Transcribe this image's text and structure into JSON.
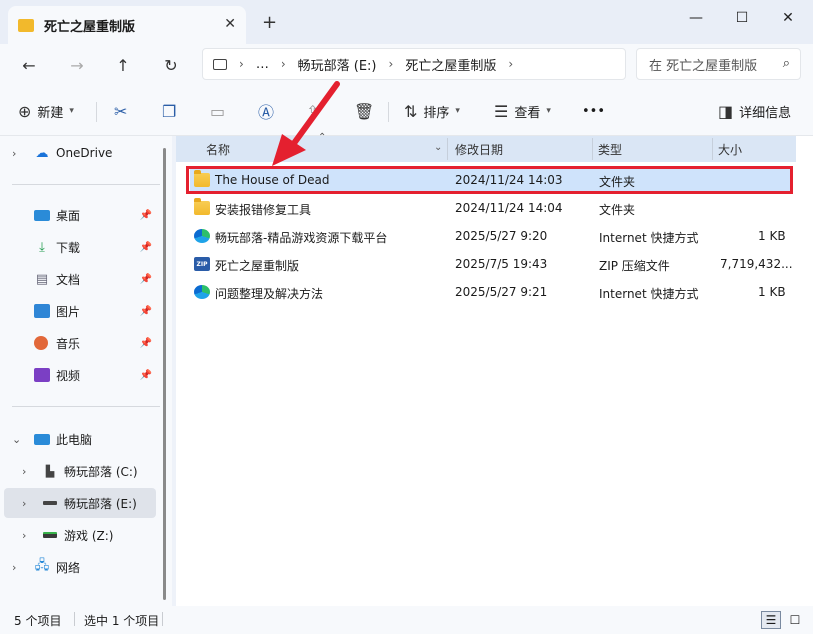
{
  "window": {
    "tab_title": "死亡之屋重制版",
    "close_tab": "✕",
    "new_tab": "+",
    "minimize": "—",
    "maximize": "☐",
    "close": "✕"
  },
  "nav": {
    "back": "←",
    "forward": "→",
    "up": "↑",
    "refresh": "↻",
    "breadcrumbs": [
      "…",
      "畅玩部落 (E:)",
      "死亡之屋重制版"
    ],
    "search_placeholder": "在 死亡之屋重制版"
  },
  "toolbar": {
    "new_label": "新建",
    "sort_label": "排序",
    "view_label": "查看",
    "more_label": "•••",
    "details_label": "详细信息"
  },
  "sidebar": {
    "items": [
      {
        "label": "OneDrive",
        "icon": "cloud-icon"
      },
      {
        "label": "桌面",
        "icon": "desktop-icon",
        "pinned": true
      },
      {
        "label": "下载",
        "icon": "download-icon",
        "pinned": true
      },
      {
        "label": "文档",
        "icon": "document-icon",
        "pinned": true
      },
      {
        "label": "图片",
        "icon": "picture-icon",
        "pinned": true
      },
      {
        "label": "音乐",
        "icon": "music-icon",
        "pinned": true
      },
      {
        "label": "视频",
        "icon": "video-icon",
        "pinned": true
      },
      {
        "label": "此电脑",
        "icon": "pc-icon"
      },
      {
        "label": "畅玩部落 (C:)",
        "icon": "drive-icon"
      },
      {
        "label": "畅玩部落 (E:)",
        "icon": "drive-icon",
        "selected": true
      },
      {
        "label": "游戏 (Z:)",
        "icon": "drive-icon"
      },
      {
        "label": "网络",
        "icon": "network-icon"
      }
    ]
  },
  "columns": [
    "名称",
    "修改日期",
    "类型",
    "大小"
  ],
  "files": [
    {
      "name": "The House of Dead",
      "date": "2024/11/24 14:03",
      "type": "文件夹",
      "size": "",
      "icon": "folder-icon"
    },
    {
      "name": "安装报错修复工具",
      "date": "2024/11/24 14:04",
      "type": "文件夹",
      "size": "",
      "icon": "folder-icon"
    },
    {
      "name": "畅玩部落-精品游戏资源下载平台",
      "date": "2025/5/27 9:20",
      "type": "Internet 快捷方式",
      "size": "1 KB",
      "icon": "internet-shortcut-icon"
    },
    {
      "name": "死亡之屋重制版",
      "date": "2025/7/5 19:43",
      "type": "ZIP 压缩文件",
      "size": "7,719,432...",
      "icon": "zip-icon"
    },
    {
      "name": "问题整理及解决方法",
      "date": "2025/5/27 9:21",
      "type": "Internet 快捷方式",
      "size": "1 KB",
      "icon": "internet-shortcut-icon"
    }
  ],
  "status": {
    "count": "5 个项目",
    "selected": "选中 1 个项目"
  },
  "colors": {
    "highlight": "#cfe3fb",
    "annotation_red": "#e4202f",
    "header_bg": "#dae6f5"
  }
}
